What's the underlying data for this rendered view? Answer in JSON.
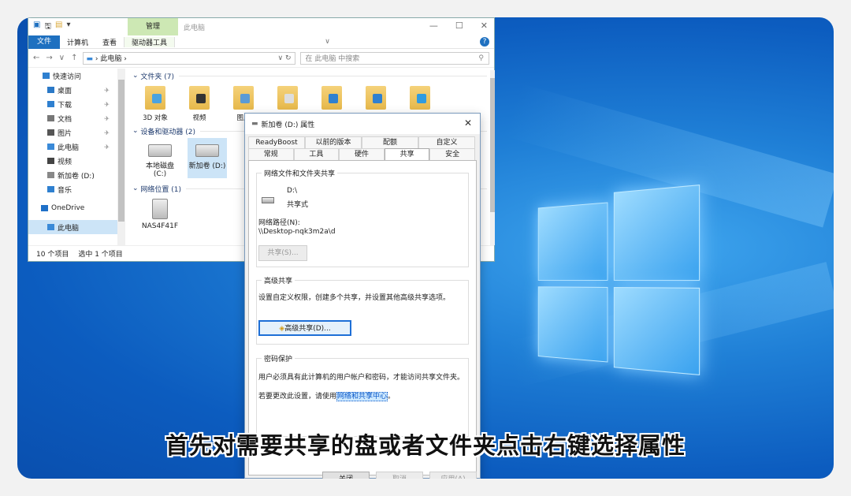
{
  "explorer": {
    "title": "此电脑",
    "quick_access_glyphs": [
      "▣",
      "🖫",
      "▤",
      "▾"
    ],
    "manage_tab": "管理",
    "ribbon": {
      "file": "文件",
      "computer": "计算机",
      "view": "查看",
      "drive_tools": "驱动器工具"
    },
    "nav_arrows": {
      "back": "←",
      "forward": "→",
      "down": "∨",
      "up": "↑"
    },
    "address": "› 此电脑 ›",
    "search_placeholder": "在 此电脑 中搜索",
    "nav_items": [
      {
        "label": "快速访问",
        "icon": "star-icon",
        "color": "#2f80d0",
        "pinned": false
      },
      {
        "label": "桌面",
        "icon": "desktop-icon",
        "color": "#2b79c7",
        "pinned": true
      },
      {
        "label": "下载",
        "icon": "download-icon",
        "color": "#2f80d0",
        "pinned": true
      },
      {
        "label": "文档",
        "icon": "document-icon",
        "color": "#777",
        "pinned": true
      },
      {
        "label": "图片",
        "icon": "picture-icon",
        "color": "#555",
        "pinned": true
      },
      {
        "label": "此电脑",
        "icon": "computer-icon",
        "color": "#3a8ad8",
        "pinned": true
      },
      {
        "label": "视频",
        "icon": "video-icon",
        "color": "#444",
        "pinned": false
      },
      {
        "label": "新加卷 (D:)",
        "icon": "drive-icon",
        "color": "#888",
        "pinned": false
      },
      {
        "label": "音乐",
        "icon": "music-icon",
        "color": "#2f80d0",
        "pinned": false
      },
      {
        "label": "OneDrive",
        "icon": "cloud-icon",
        "color": "#1f70c8",
        "pinned": false
      },
      {
        "label": "此电脑",
        "icon": "computer-icon",
        "color": "#3a8ad8",
        "pinned": false
      }
    ],
    "pin_glyph": "✈",
    "group_folders": "文件夹 (7)",
    "folders": [
      {
        "label": "3D 对象",
        "overlay": "#4aa3e0"
      },
      {
        "label": "视频",
        "overlay": "#333"
      },
      {
        "label": "图片",
        "overlay": "#5b9bd5"
      },
      {
        "label": "",
        "overlay": "#ddd"
      },
      {
        "label": "",
        "overlay": "#2f80d0"
      },
      {
        "label": "",
        "overlay": "#2f80d0"
      },
      {
        "label": "",
        "overlay": "#2f9be0"
      }
    ],
    "group_drives": "设备和驱动器 (2)",
    "drives": [
      {
        "label": "本地磁盘 (C:)"
      },
      {
        "label": "新加卷 (D:)"
      }
    ],
    "group_network": "网络位置 (1)",
    "network": [
      {
        "label": "NAS4F41F"
      }
    ],
    "status_count": "10 个项目",
    "status_selected": "选中 1 个项目"
  },
  "dialog": {
    "title": "新加卷 (D:) 属性",
    "close": "✕",
    "tabs_row1": [
      "ReadyBoost",
      "以前的版本",
      "配额",
      "自定义"
    ],
    "tabs_row2": [
      "常规",
      "工具",
      "硬件",
      "共享",
      "安全"
    ],
    "active_tab": "共享",
    "share_group": {
      "label": "网络文件和文件夹共享",
      "drive": "D:\\",
      "state": "共享式",
      "path_label": "网络路径(N):",
      "path": "\\\\Desktop-nqk3m2a\\d",
      "button": "共享(S)..."
    },
    "adv_group": {
      "label": "高级共享",
      "desc": "设置自定义权限，创建多个共享，并设置其他高级共享选项。",
      "button": "高级共享(D)..."
    },
    "pwd_group": {
      "label": "密码保护",
      "desc": "用户必须具有此计算机的用户帐户和密码，才能访问共享文件夹。",
      "change_prefix": "若要更改此设置，请使用",
      "link": "网络和共享中心",
      "suffix": "。"
    },
    "buttons": {
      "close": "关闭",
      "cancel": "取消",
      "apply": "应用(A)"
    }
  },
  "caption": "首先对需要共享的盘或者文件夹点击右键选择属性",
  "colors": {
    "desktop": "#1f7fd6",
    "accent": "#1e70c0"
  }
}
